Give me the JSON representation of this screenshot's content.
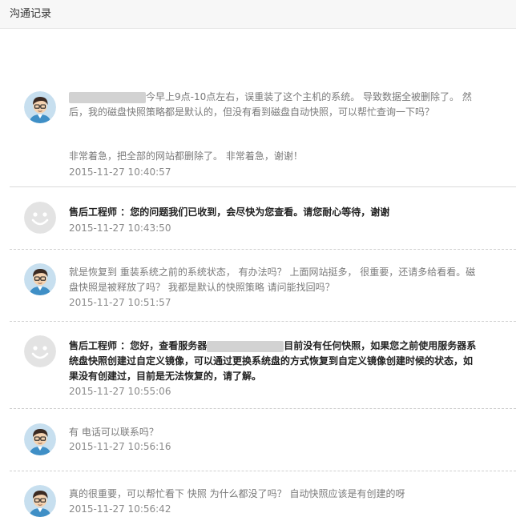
{
  "header": {
    "title": "沟通记录"
  },
  "messages": [
    {
      "role": "user",
      "paragraphs": [
        "今早上9点-10点左右，误重装了这个主机的系统。 导致数据全被删除了。 然后，我的磁盘快照策略都是默认的，但没有看到磁盘自动快照，可以帮忙查询一下吗？",
        "非常着急，把全部的网站都删除了。 非常着急，谢谢！"
      ],
      "time": "2015-11-27 10:40:57"
    },
    {
      "role": "staff",
      "sender": "售后工程师 ：",
      "paragraphs": [
        "您的问题我们已收到，会尽快为您查看。请您耐心等待，谢谢"
      ],
      "time": "2015-11-27 10:43:50"
    },
    {
      "role": "user",
      "paragraphs": [
        "就是恢复到  重装系统之前的系统状态， 有办法吗？  上面网站挺多， 很重要，还请多给看看。磁盘快照是被释放了吗？  我都是默认的快照策略    请问能找回吗？"
      ],
      "time": "2015-11-27 10:51:57"
    },
    {
      "role": "staff",
      "sender": "售后工程师 ：",
      "paragraphs": [
        "您好，查看服务器",
        "目前没有任何快照，如果您之前使用服务器系统盘快照创建过自定义镜像，可以通过更换系统盘的方式恢复到自定义镜像创建时候的状态，如果没有创建过，目前是无法恢复的，请了解。"
      ],
      "time": "2015-11-27 10:55:06"
    },
    {
      "role": "user",
      "paragraphs": [
        "有 电话可以联系吗？"
      ],
      "time": "2015-11-27 10:56:16"
    },
    {
      "role": "user",
      "paragraphs": [
        "真的很重要，可以帮忙看下 快照 为什么都没了吗？  自动快照应该是有创建的呀"
      ],
      "time": "2015-11-27 10:56:42"
    }
  ]
}
